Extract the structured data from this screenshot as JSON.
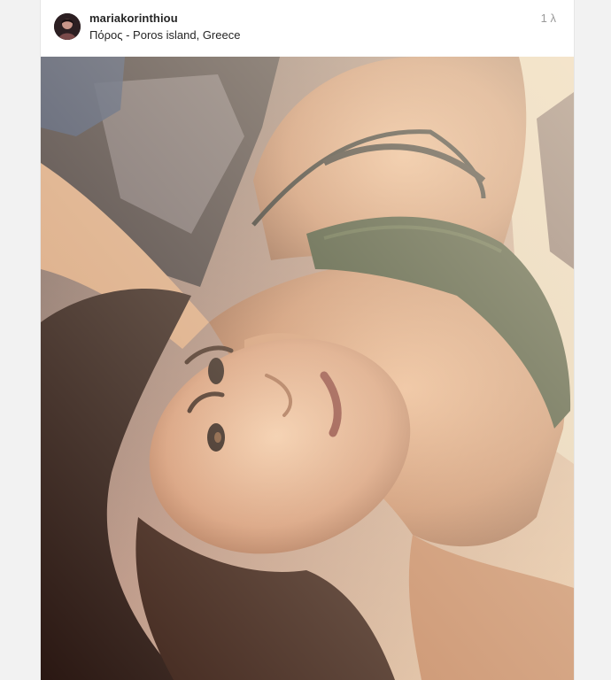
{
  "post": {
    "username": "mariakorinthiou",
    "location": "Πόρος - Poros island, Greece",
    "timestamp": "1 λ",
    "avatar_icon": "profile-avatar",
    "photo_alt": "photo"
  },
  "colors": {
    "username": "#262626",
    "timestamp": "#999999",
    "border": "#e6e6e6"
  }
}
